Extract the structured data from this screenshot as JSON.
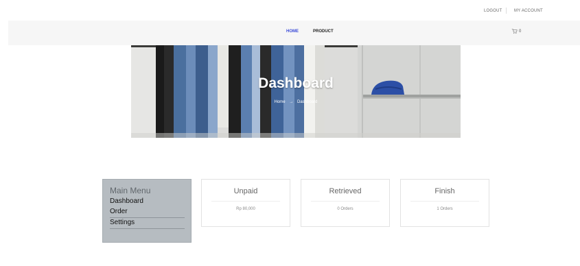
{
  "topbar": {
    "logout": "LOGOUT",
    "my_account": "MY ACCOUNT"
  },
  "nav": {
    "home": "HOME",
    "product": "PRODUCT",
    "cart_count": "0"
  },
  "banner": {
    "title": "Dashboard",
    "breadcrumb_home": "Home",
    "breadcrumb_arrow": "→",
    "breadcrumb_current": "Dashboard"
  },
  "sidebar": {
    "title": "Main Menu",
    "items": [
      {
        "label": "Dashboard"
      },
      {
        "label": "Order"
      },
      {
        "label": "Settings"
      }
    ]
  },
  "cards": [
    {
      "title": "Unpaid",
      "value": "Rp 80,000"
    },
    {
      "title": "Retrieved",
      "value": "0 Orders"
    },
    {
      "title": "Finish",
      "value": "1 Orders"
    }
  ],
  "colors": {
    "accent": "#3b4bd8",
    "sidebar_bg": "#b6bcc1"
  }
}
